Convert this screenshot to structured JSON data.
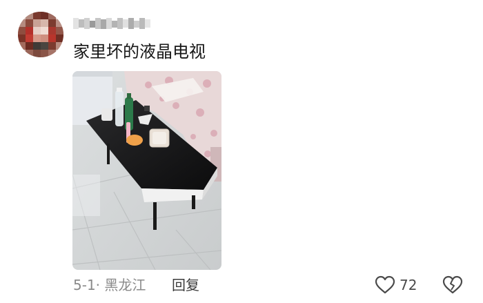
{
  "comment": {
    "text": "家里坏的液晶电视",
    "date_location": "5-1· 黑龙江",
    "reply_label": "回复",
    "like_count": "72"
  },
  "icons": {
    "avatar": "avatar",
    "like": "heart-outline-icon",
    "dislike": "broken-heart-icon"
  },
  "colors": {
    "text": "#161616",
    "meta": "#8a8a8a",
    "icon": "#4a4a4a"
  }
}
